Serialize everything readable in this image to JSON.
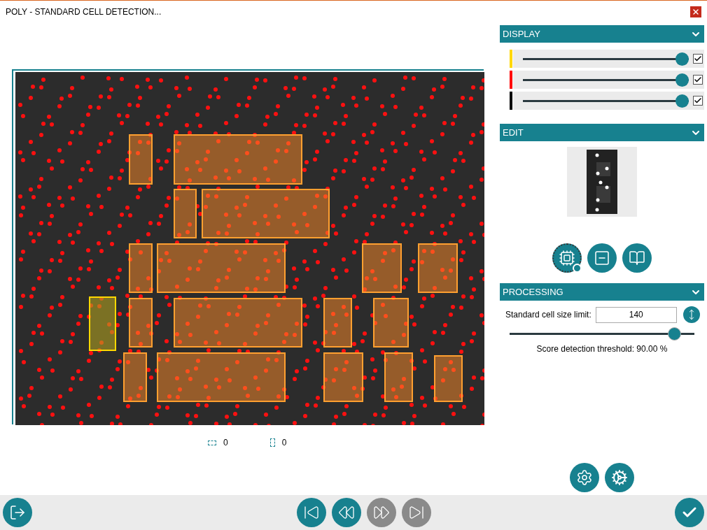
{
  "window": {
    "title": "POLY - STANDARD CELL DETECTION..."
  },
  "counts": [
    {
      "kind": "horizontal",
      "value": "0"
    },
    {
      "kind": "vertical",
      "value": "0"
    }
  ],
  "display": {
    "title": "DISPLAY",
    "expanded": true,
    "layers": [
      {
        "color": "#ffd800",
        "level": 1,
        "checked": true
      },
      {
        "color": "#ff0000",
        "level": 1,
        "checked": true
      },
      {
        "color": "#000000",
        "level": 1,
        "checked": true
      }
    ]
  },
  "edit": {
    "title": "EDIT",
    "expanded": true,
    "tools": [
      {
        "kind": "chip",
        "selected": true
      },
      {
        "kind": "window",
        "selected": false
      },
      {
        "kind": "book",
        "selected": false
      }
    ]
  },
  "processing": {
    "title": "PROCESSING",
    "expanded": true,
    "size_label": "Standard cell size limit:",
    "size_value": "140",
    "threshold": {
      "level": 0.89
    },
    "threshold_label": "Score detection threshold: 90.00 %"
  },
  "navigation": [
    {
      "kind": "first",
      "disabled": false
    },
    {
      "kind": "back",
      "disabled": false
    },
    {
      "kind": "forward",
      "disabled": true
    },
    {
      "kind": "last",
      "disabled": true
    }
  ]
}
